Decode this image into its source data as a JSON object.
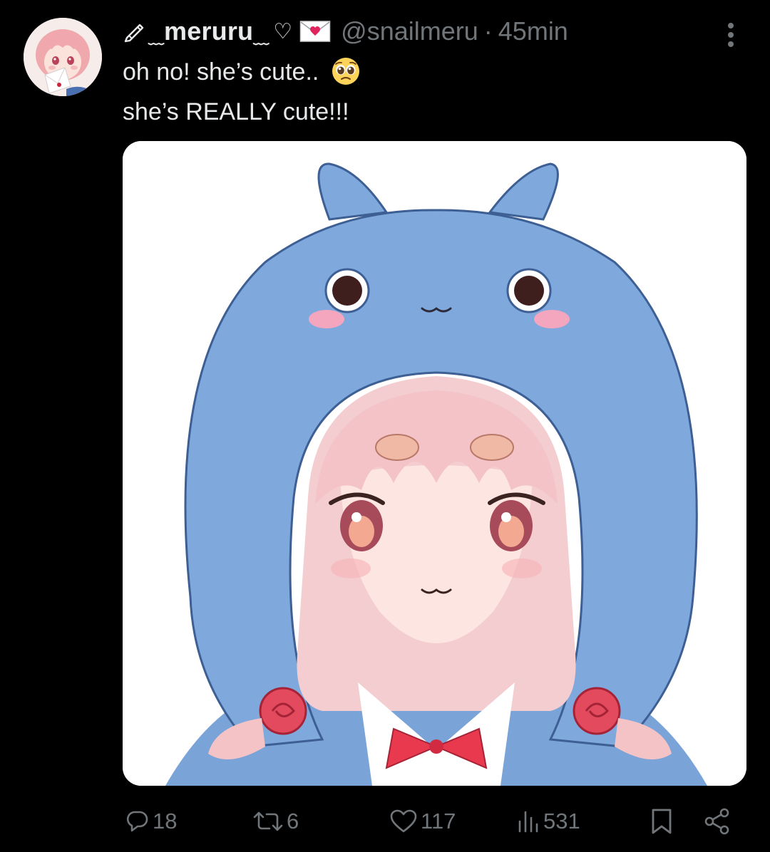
{
  "tweet": {
    "display_name": "meruru",
    "display_prefix_icon": "pencil-icon",
    "display_suffix_icons": [
      "heart-outline-icon",
      "envelope-heart-icon"
    ],
    "handle": "@snailmeru",
    "separator": "·",
    "time": "45min",
    "text_line1": "oh no! she’s cute..",
    "text_line1_emoji": "pleading-face-emoji",
    "text_line2": "she’s REALLY cute!!!",
    "media_alt_icon": "anime-girl-blue-hood-image"
  },
  "actions": {
    "reply_count": "18",
    "retweet_count": "6",
    "like_count": "117",
    "views_count": "531",
    "bookmark_icon": "bookmark-icon",
    "share_icon": "share-icon"
  },
  "colors": {
    "background": "#000000",
    "primary_text": "#e7e9ea",
    "secondary_text": "#71767b",
    "hood_blue": "#7fa9dd",
    "hair_pink": "#f4c6c6"
  }
}
